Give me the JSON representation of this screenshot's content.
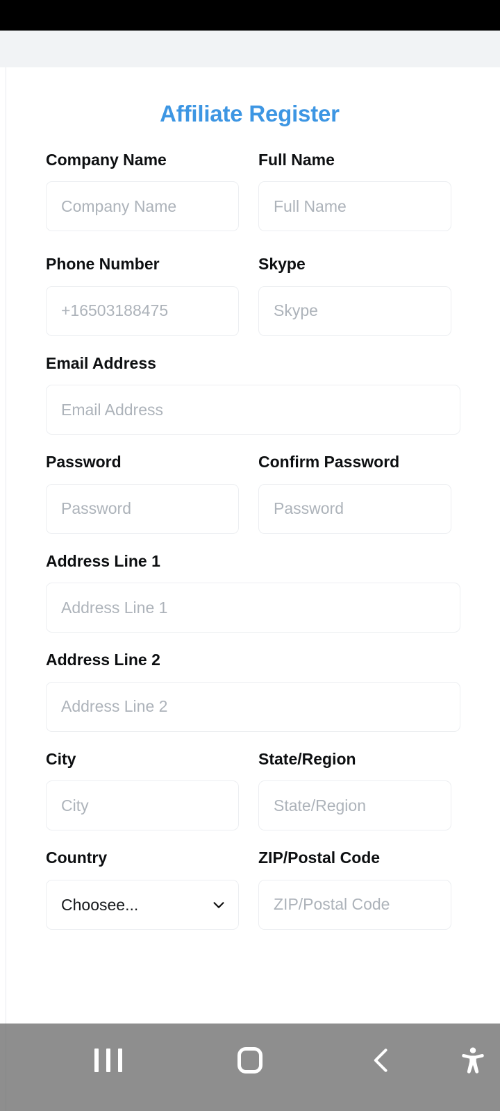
{
  "screen": {
    "status_bar_color": "#000000",
    "background_color": "#f1f3f5",
    "card_color": "#ffffff"
  },
  "form": {
    "title": "Affiliate Register",
    "title_color": "#3d96e3",
    "fields": {
      "company_name": {
        "label": "Company Name",
        "placeholder": "Company Name",
        "value": ""
      },
      "full_name": {
        "label": "Full Name",
        "placeholder": "Full Name",
        "value": ""
      },
      "phone_number": {
        "label": "Phone Number",
        "placeholder": "+16503188475",
        "value": ""
      },
      "skype": {
        "label": "Skype",
        "placeholder": "Skype",
        "value": ""
      },
      "email_address": {
        "label": "Email Address",
        "placeholder": "Email Address",
        "value": ""
      },
      "password": {
        "label": "Password",
        "placeholder": "Password",
        "value": ""
      },
      "confirm_password": {
        "label": "Confirm Password",
        "placeholder": "Password",
        "value": ""
      },
      "address_line_1": {
        "label": "Address Line 1",
        "placeholder": "Address Line 1",
        "value": ""
      },
      "address_line_2": {
        "label": "Address Line 2",
        "placeholder": "Address Line 2",
        "value": ""
      },
      "city": {
        "label": "City",
        "placeholder": "City",
        "value": ""
      },
      "state_region": {
        "label": "State/Region",
        "placeholder": "State/Region",
        "value": ""
      },
      "country": {
        "label": "Country",
        "selected": "Choosee...",
        "options": [
          "Choosee..."
        ]
      },
      "zip_postal_code": {
        "label": "ZIP/Postal Code",
        "placeholder": "ZIP/Postal Code",
        "value": ""
      }
    }
  },
  "nav_bar": {
    "recents_label": "recent-apps",
    "home_label": "home",
    "back_label": "back",
    "accessibility_label": "accessibility"
  }
}
